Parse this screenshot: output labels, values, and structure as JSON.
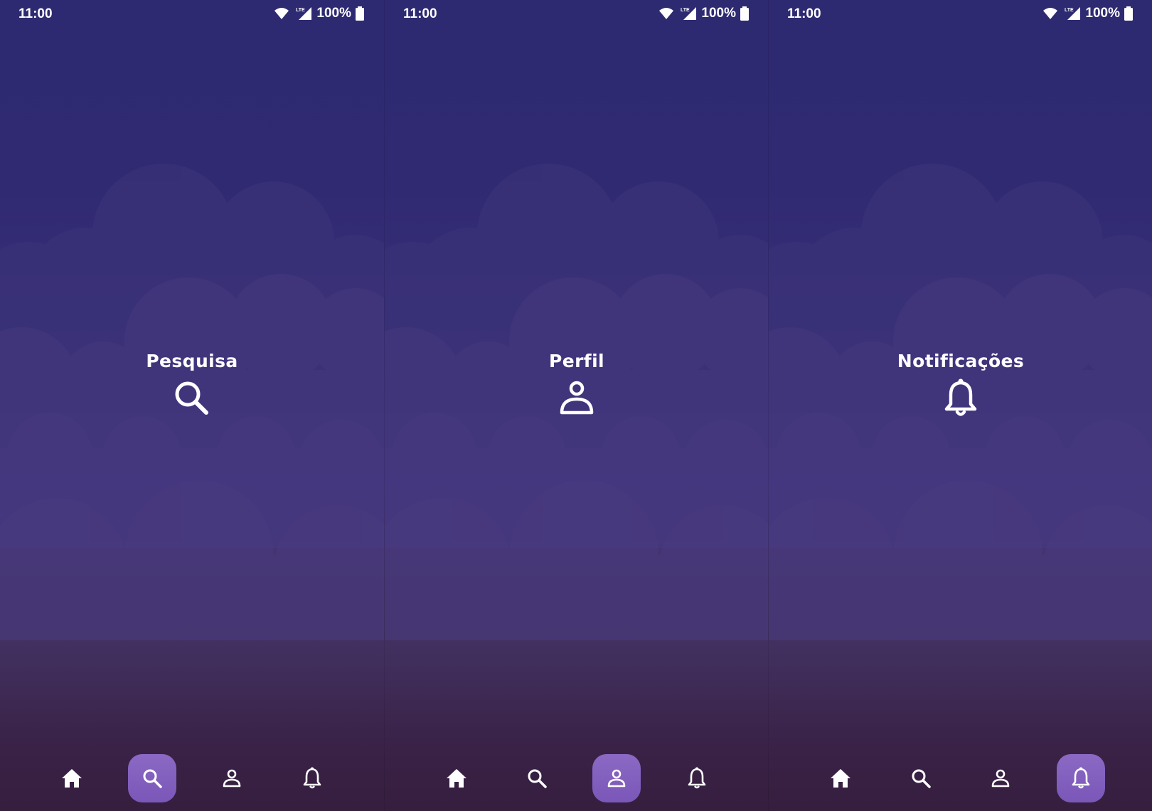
{
  "colors": {
    "background_top": "#2e2a71",
    "background_bottom": "#351e3e",
    "active_nav": "#8b69c4",
    "text": "#ffffff"
  },
  "screens": [
    {
      "status": {
        "time": "11:00",
        "network": "LTE",
        "battery": "100%"
      },
      "title": "Pesquisa",
      "icon": "search-icon",
      "active_tab": "search"
    },
    {
      "status": {
        "time": "11:00",
        "network": "LTE",
        "battery": "100%"
      },
      "title": "Perfil",
      "icon": "person-icon",
      "active_tab": "profile"
    },
    {
      "status": {
        "time": "11:00",
        "network": "LTE",
        "battery": "100%"
      },
      "title": "Notificações",
      "icon": "bell-icon",
      "active_tab": "notifications"
    }
  ],
  "nav_tabs": [
    {
      "id": "home",
      "icon": "home-icon"
    },
    {
      "id": "search",
      "icon": "search-icon"
    },
    {
      "id": "profile",
      "icon": "person-icon"
    },
    {
      "id": "notifications",
      "icon": "bell-icon"
    }
  ]
}
